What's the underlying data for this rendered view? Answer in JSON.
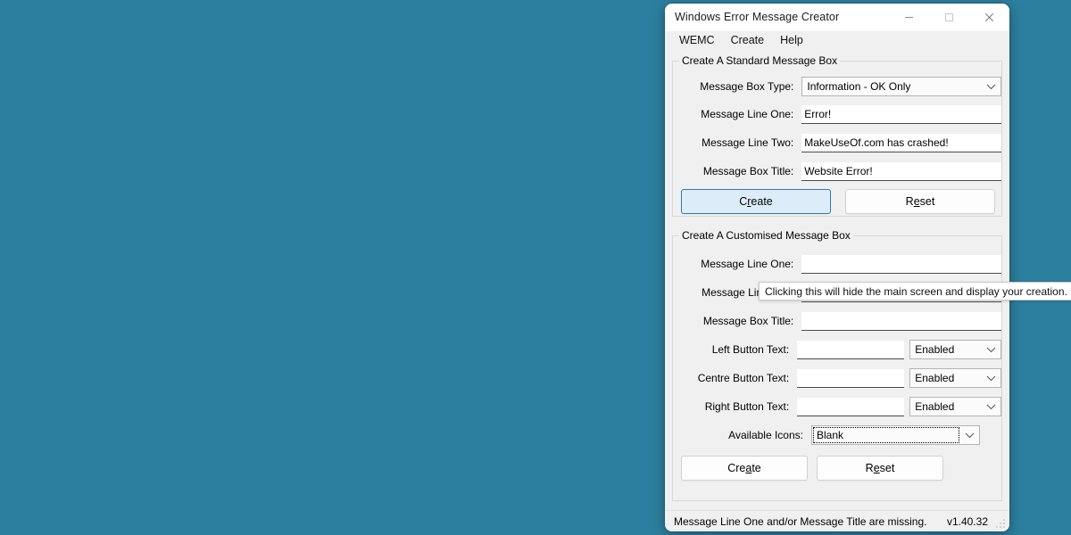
{
  "desktop": {
    "background_color": "#2c7f9e"
  },
  "window": {
    "title": "Windows Error Message Creator",
    "controls": {
      "minimize": "minimize-icon",
      "maximize": "maximize-icon",
      "close": "close-icon"
    }
  },
  "menu": {
    "items": [
      {
        "label": "WEMC"
      },
      {
        "label": "Create"
      },
      {
        "label": "Help"
      }
    ]
  },
  "standard_group": {
    "title": "Create A Standard Message Box",
    "fields": {
      "message_box_type_label": "Message Box Type:",
      "message_box_type_value": "Information - OK Only",
      "message_line_one_label": "Message Line One:",
      "message_line_one_value": "Error!",
      "message_line_two_label": "Message Line Two:",
      "message_line_two_value": "MakeUseOf.com has crashed!",
      "message_box_title_label": "Message Box Title:",
      "message_box_title_value": "Website Error!"
    },
    "buttons": {
      "create": "Create",
      "create_accel_pre": "C",
      "create_accel_key": "r",
      "create_accel_post": "eate",
      "reset": "Reset",
      "reset_accel_pre": "R",
      "reset_accel_key": "e",
      "reset_accel_post": "set"
    }
  },
  "tooltip": {
    "text": "Clicking this will hide the main screen and display your creation."
  },
  "custom_group": {
    "title": "Create A Customised Message Box",
    "fields": {
      "message_line_one_label": "Message Line One:",
      "message_line_one_value": "",
      "message_line_two_label": "Message Line Two:",
      "message_line_two_value": "",
      "message_box_title_label": "Message Box Title:",
      "message_box_title_value": "",
      "left_button_label": "Left Button Text:",
      "left_button_value": "",
      "left_button_state": "Enabled",
      "centre_button_label": "Centre Button Text:",
      "centre_button_value": "",
      "centre_button_state": "Enabled",
      "right_button_label": "Right Button Text:",
      "right_button_value": "",
      "right_button_state": "Enabled",
      "available_icons_label": "Available Icons:",
      "available_icons_value": "Blank"
    },
    "buttons": {
      "create_accel_pre": "Cre",
      "create_accel_key": "a",
      "create_accel_post": "te",
      "reset_accel_pre": "R",
      "reset_accel_key": "e",
      "reset_accel_post": "set"
    }
  },
  "status_bar": {
    "message": "Message Line One and/or Message Title are missing.",
    "version": "v1.40.32"
  },
  "colors": {
    "accent_button_fill": "#dcedf9",
    "accent_button_border": "#2b7cb5",
    "window_bg": "#f0f0f0",
    "input_bg": "#ffffff"
  }
}
